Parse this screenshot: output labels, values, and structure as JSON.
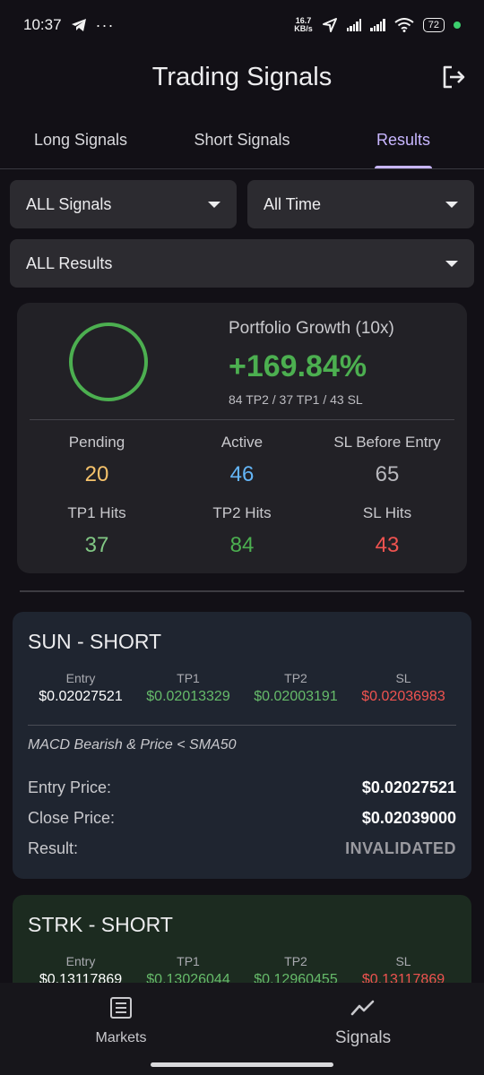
{
  "status_bar": {
    "time": "10:37",
    "speed_value": "16.7",
    "speed_unit": "KB/s",
    "battery": "72"
  },
  "header": {
    "title": "Trading Signals"
  },
  "tabs": [
    {
      "label": "Long Signals",
      "active": false
    },
    {
      "label": "Short Signals",
      "active": false
    },
    {
      "label": "Results",
      "active": true
    }
  ],
  "filters": {
    "signal_type": "ALL Signals",
    "time_range": "All Time",
    "result": "ALL Results"
  },
  "portfolio": {
    "label": "Portfolio Growth (10x)",
    "value": "+169.84%",
    "breakdown": "84 TP2 / 37 TP1 / 43 SL"
  },
  "stats": [
    {
      "label": "Pending",
      "value": "20",
      "color": "#f5c26b"
    },
    {
      "label": "Active",
      "value": "46",
      "color": "#64b5f6"
    },
    {
      "label": "SL Before Entry",
      "value": "65",
      "color": "#b8b8bd"
    },
    {
      "label": "TP1 Hits",
      "value": "37",
      "color": "#81c784"
    },
    {
      "label": "TP2 Hits",
      "value": "84",
      "color": "#4caf50"
    },
    {
      "label": "SL Hits",
      "value": "43",
      "color": "#ef5350"
    }
  ],
  "signals": [
    {
      "title": "SUN - SHORT",
      "levels": {
        "entry_label": "Entry",
        "entry": "$0.02027521",
        "tp1_label": "TP1",
        "tp1": "$0.02013329",
        "tp2_label": "TP2",
        "tp2": "$0.02003191",
        "sl_label": "SL",
        "sl": "$0.02036983"
      },
      "strategy": "MACD Bearish & Price < SMA50",
      "entry_price_label": "Entry Price:",
      "entry_price": "$0.02027521",
      "close_price_label": "Close Price:",
      "close_price": "$0.02039000",
      "result_label": "Result:",
      "result": "INVALIDATED",
      "bg": "#1f2530"
    },
    {
      "title": "STRK - SHORT",
      "levels": {
        "entry_label": "Entry",
        "entry": "$0.13117869",
        "tp1_label": "TP1",
        "tp1": "$0.13026044",
        "tp2_label": "TP2",
        "tp2": "$0.12960455",
        "sl_label": "SL",
        "sl": "$0.13117869"
      },
      "bg": "#1c2b20"
    }
  ],
  "colors": {
    "green": "#4caf50",
    "red": "#ef5350",
    "accent": "#c8b6ff"
  },
  "bottom_nav": {
    "markets_label": "Markets",
    "signals_label": "Signals"
  }
}
